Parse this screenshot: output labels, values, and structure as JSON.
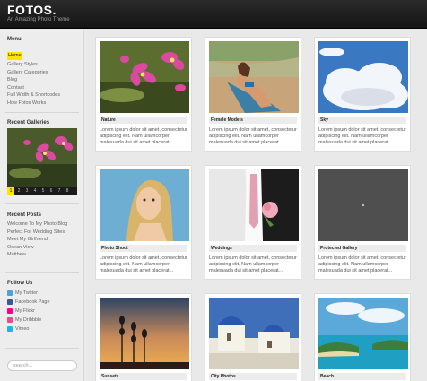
{
  "site": {
    "logo": "FOTOS.",
    "tagline": "An Amazing Photo Theme"
  },
  "sidebar": {
    "menu": {
      "title": "Menu",
      "items": [
        "Home",
        "Gallery Styles",
        "Gallery Categories",
        "Blog",
        "Contact",
        "Full Width & Shortcodes",
        "How Fotos Works"
      ]
    },
    "recent_galleries": {
      "title": "Recent Galleries",
      "pages": [
        "1",
        "2",
        "3",
        "4",
        "5",
        "6",
        "7",
        "8"
      ]
    },
    "recent_posts": {
      "title": "Recent Posts",
      "items": [
        "Welcome To My Photo Blog",
        "Perfect For Wedding Sites",
        "Meet My Girlfriend",
        "Ocean View",
        "Matthew"
      ]
    },
    "follow_us": {
      "title": "Follow Us",
      "items": [
        {
          "label": "My Twitter",
          "icon": "twitter-icon",
          "color": "#4aa3df"
        },
        {
          "label": "Facebook Page",
          "icon": "facebook-icon",
          "color": "#3b5998"
        },
        {
          "label": "My Flickr",
          "icon": "flickr-icon",
          "color": "#ff0084"
        },
        {
          "label": "My Dribbble",
          "icon": "dribbble-icon",
          "color": "#ea4c89"
        },
        {
          "label": "Vimeo",
          "icon": "vimeo-icon",
          "color": "#1ab7ea"
        }
      ]
    },
    "search": {
      "placeholder": "search..."
    }
  },
  "gallery": {
    "description": "Lorem ipsum dolor sit amet, consectetur adipiscing elit. Nam ullamcorper malesuada dui sit amet placerat...",
    "cards": [
      {
        "caption": "Nature"
      },
      {
        "caption": "Female Models"
      },
      {
        "caption": "Sky"
      },
      {
        "caption": "Photo Shoot"
      },
      {
        "caption": "Weddings"
      },
      {
        "caption": "Protected Gallery"
      },
      {
        "caption": "Sunsets"
      },
      {
        "caption": "City Photos"
      },
      {
        "caption": "Beach"
      }
    ]
  }
}
